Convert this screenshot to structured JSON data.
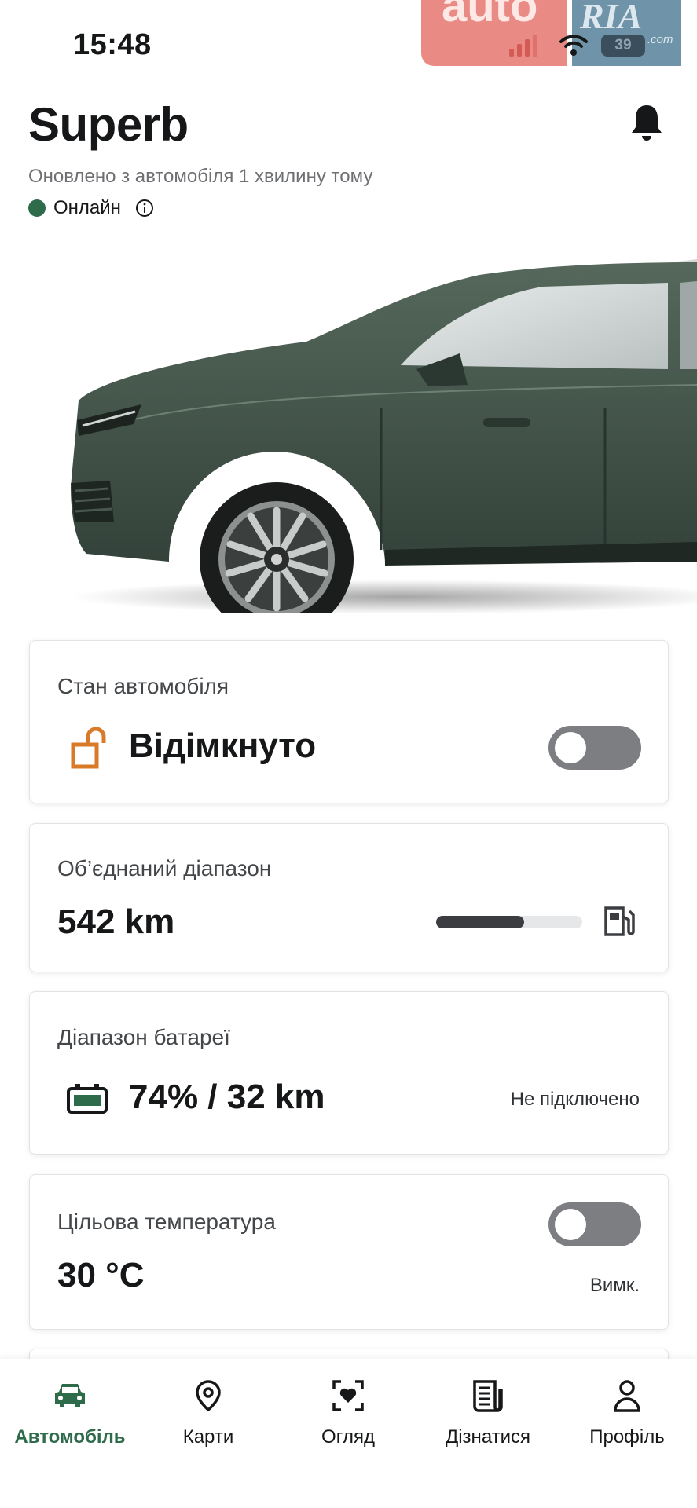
{
  "status_bar": {
    "time": "15:48",
    "battery": "39"
  },
  "watermark": {
    "left": "auto",
    "right": "RIA",
    "suffix": ".com"
  },
  "header": {
    "title": "Superb",
    "updated": "Оновлено з автомобіля 1 хвилину тому",
    "online": "Онлайн"
  },
  "cards": {
    "vehicle_state": {
      "label": "Стан автомобіля",
      "value": "Відімкнуто"
    },
    "combined_range": {
      "label": "Об’єднаний діапазон",
      "value": "542 km",
      "level": 0.6
    },
    "battery_range": {
      "label": "Діапазон батареї",
      "value": "74% / 32 km",
      "status": "Не підключено"
    },
    "target_temp": {
      "label": "Цільова температура",
      "value": "30 °C",
      "status": "Вимк."
    }
  },
  "nav": {
    "items": [
      {
        "label": "Автомобіль",
        "icon": "car-icon",
        "active": true
      },
      {
        "label": "Карти",
        "icon": "map-pin-icon"
      },
      {
        "label": "Огляд",
        "icon": "explore-icon"
      },
      {
        "label": "Дізнатися",
        "icon": "news-icon"
      },
      {
        "label": "Профіль",
        "icon": "profile-icon"
      }
    ]
  },
  "colors": {
    "accent": "#2e6b4a",
    "lock_orange": "#d97a28",
    "toggle_off": "#7c7e81"
  }
}
